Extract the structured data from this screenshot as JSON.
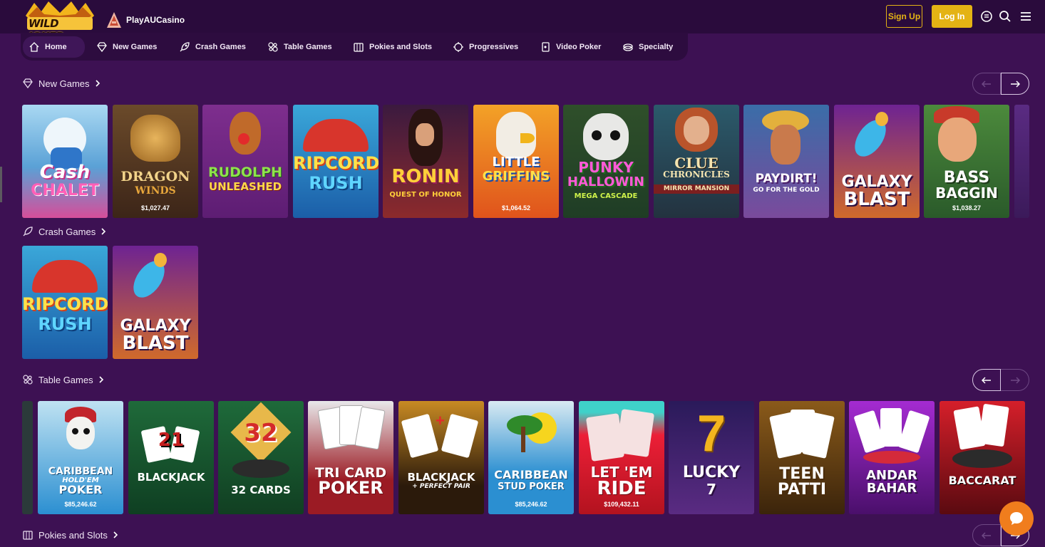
{
  "header": {
    "logo_text": "WILD JOKER",
    "brand_name": "PlayAUCasino",
    "signup_label": "Sign Up",
    "login_label": "Log In",
    "icons": [
      "chat-bubble-icon",
      "search-icon",
      "hamburger-menu-icon"
    ]
  },
  "categories": [
    {
      "label": "Home",
      "icon": "home-icon",
      "active": true
    },
    {
      "label": "New Games",
      "icon": "diamond-icon"
    },
    {
      "label": "Crash Games",
      "icon": "rocket-icon"
    },
    {
      "label": "Table Games",
      "icon": "chips-icon"
    },
    {
      "label": "Pokies and Slots",
      "icon": "slot-machine-icon"
    },
    {
      "label": "Progressives",
      "icon": "coin-icon"
    },
    {
      "label": "Video Poker",
      "icon": "cards-icon"
    },
    {
      "label": "Specialty",
      "icon": "dice-icon"
    }
  ],
  "sections": {
    "new_games": {
      "title": "New Games",
      "games": [
        {
          "name": "Cash Chalet",
          "line1": "Cash",
          "line2": "CHALET"
        },
        {
          "name": "Dragon Winds",
          "line1": "DRAGON",
          "line2": "WINDS",
          "amount": "$1,027.47"
        },
        {
          "name": "Rudolph Unleashed",
          "line1": "RUDOLPH",
          "line2": "UNLEASHED"
        },
        {
          "name": "Ripcord Rush",
          "line1": "RIPCORD",
          "line2": "RUSH"
        },
        {
          "name": "Ronin Quest of Honor",
          "line1": "RONIN",
          "line2": "QUEST OF HONOR"
        },
        {
          "name": "Little Griffins",
          "line1": "LITTLE",
          "line2": "GRIFFINS",
          "amount": "$1,064.52"
        },
        {
          "name": "Punky Halloween",
          "line1": "PUNKY",
          "line2": "HALLOWIN",
          "line3": "MEGA CASCADE"
        },
        {
          "name": "Clue Chronicles Mirror Mansion",
          "line1": "CLUE",
          "line2": "CHRONICLES",
          "line3": "MIRROR MANSION"
        },
        {
          "name": "Paydirt! Go For The Gold",
          "line1": "PAYDIRT!",
          "line2": "GO FOR THE GOLD"
        },
        {
          "name": "Galaxy Blast",
          "line1": "GALAXY",
          "line2": "BLAST"
        },
        {
          "name": "Bass Baggin",
          "line1": "BASS",
          "line2": "BAGGIN",
          "amount": "$1,038.27"
        }
      ]
    },
    "crash_games": {
      "title": "Crash Games",
      "games": [
        {
          "name": "Ripcord Rush",
          "line1": "RIPCORD",
          "line2": "RUSH"
        },
        {
          "name": "Galaxy Blast",
          "line1": "GALAXY",
          "line2": "BLAST"
        }
      ]
    },
    "table_games": {
      "title": "Table Games",
      "games": [
        {
          "name": "Caribbean Hold'em Poker",
          "line1": "CARIBBEAN",
          "line2": "HOLD'EM",
          "line3": "POKER",
          "amount": "$85,246.62"
        },
        {
          "name": "Blackjack",
          "line1": "21",
          "line2": "BLACKJACK"
        },
        {
          "name": "32 Cards",
          "line1": "32",
          "line2": "32 CARDS"
        },
        {
          "name": "Tri Card Poker",
          "line1": "TRI CARD",
          "line2": "POKER"
        },
        {
          "name": "Blackjack + Perfect Pair",
          "line1": "BLACKJACK",
          "line2": "+ PERFECT PAIR"
        },
        {
          "name": "Caribbean Stud Poker",
          "line1": "CARIBBEAN",
          "line2": "STUD POKER",
          "amount": "$85,246.62"
        },
        {
          "name": "Let 'Em Ride",
          "line1": "LET 'EM",
          "line2": "RIDE",
          "amount": "$109,432.11"
        },
        {
          "name": "Lucky 7",
          "line1": "LUCKY",
          "line2": "7"
        },
        {
          "name": "Teen Patti",
          "line1": "TEEN",
          "line2": "PATTI"
        },
        {
          "name": "Andar Bahar",
          "line1": "ANDAR",
          "line2": "BAHAR"
        },
        {
          "name": "Baccarat",
          "line1": "BACCARAT"
        }
      ]
    },
    "pokies": {
      "title": "Pokies and Slots"
    }
  },
  "colors": {
    "accent": "#e4b314",
    "background": "#3d1153",
    "topbar": "#2a0b3c",
    "chat": "#f07d1d"
  }
}
